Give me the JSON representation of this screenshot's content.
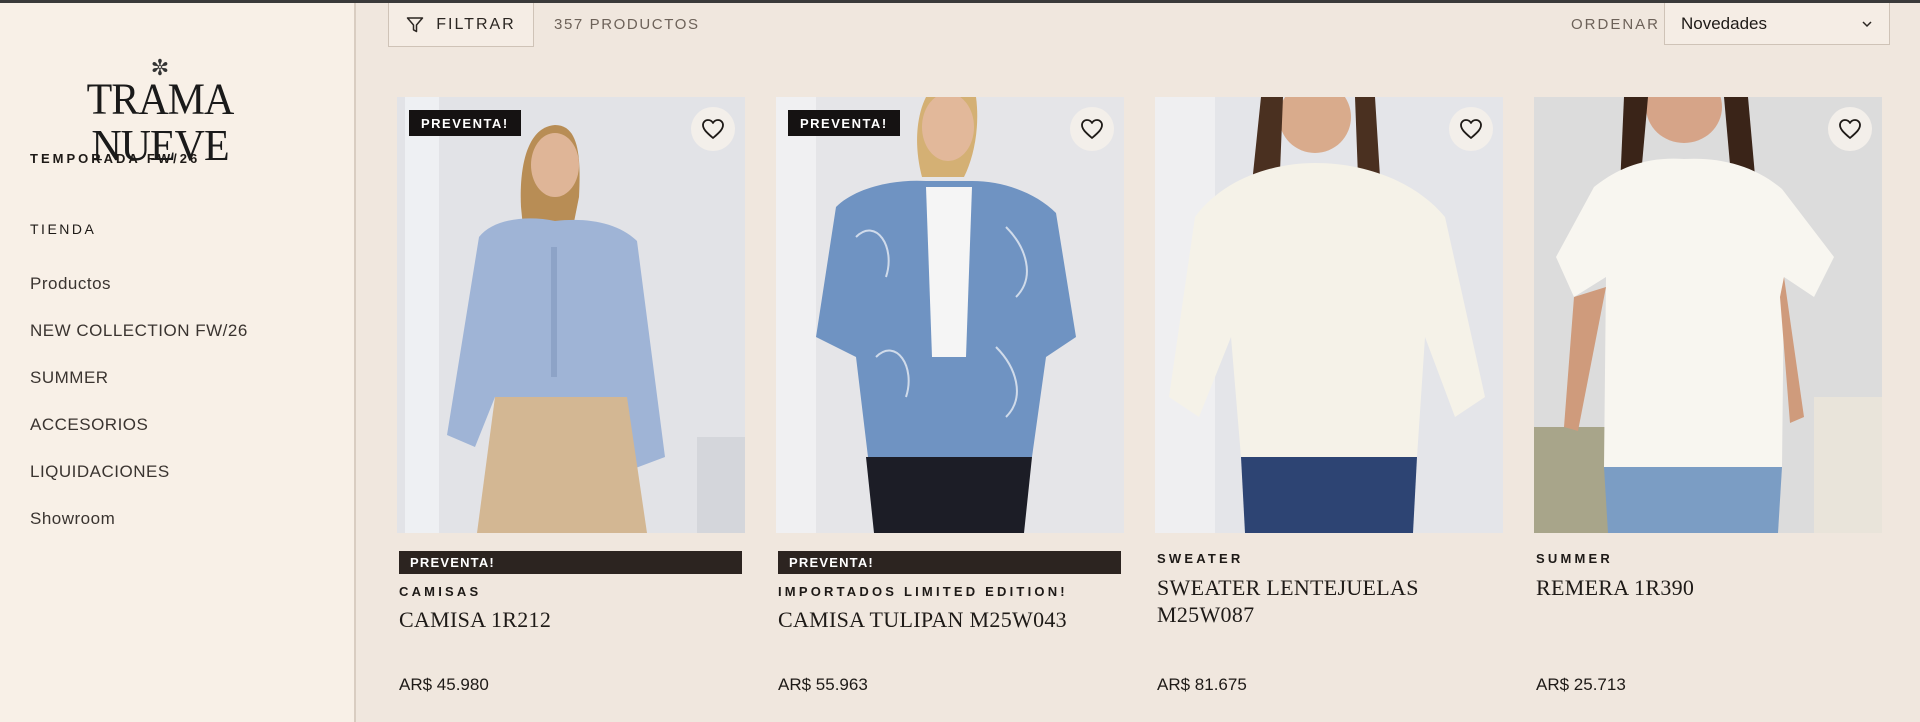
{
  "brand": {
    "logo_mark": "✼",
    "logo_text": "TRAMA NUEVE"
  },
  "sidebar": {
    "season": "TEMPORADA FW/26",
    "heading": "TIENDA",
    "items": [
      {
        "label": "Productos"
      },
      {
        "label": "NEW COLLECTION FW/26"
      },
      {
        "label": "SUMMER"
      },
      {
        "label": "ACCESORIOS"
      },
      {
        "label": "LIQUIDACIONES"
      },
      {
        "label": "Showroom"
      }
    ]
  },
  "toolbar": {
    "filter_label": "FILTRAR",
    "filter_icon": "filter-funnel-icon",
    "product_count": "357 PRODUCTOS",
    "sort_label": "ORDENAR",
    "sort_value": "Novedades"
  },
  "products": [
    {
      "badge": "PREVENTA!",
      "strip": "PREVENTA!",
      "category": "CAMISAS",
      "title": "CAMISA 1R212",
      "price": "AR$ 45.980",
      "favorite_icon": "heart-icon"
    },
    {
      "badge": "PREVENTA!",
      "strip": "PREVENTA!",
      "category": "IMPORTADOS LIMITED EDITION!",
      "title": "CAMISA TULIPAN M25W043",
      "price": "AR$ 55.963",
      "favorite_icon": "heart-icon"
    },
    {
      "category": "SWEATER",
      "title": "SWEATER LENTEJUELAS M25W087",
      "price": "AR$ 81.675",
      "favorite_icon": "heart-icon"
    },
    {
      "category": "SUMMER",
      "title": "REMERA 1R390",
      "price": "AR$ 25.713",
      "favorite_icon": "heart-icon"
    }
  ],
  "colors": {
    "page_bg": "#f0e7de",
    "sidebar_bg": "#f8f0e7",
    "badge_bg": "#151212",
    "strip_bg": "#2c2420",
    "text": "#1e1a17"
  }
}
